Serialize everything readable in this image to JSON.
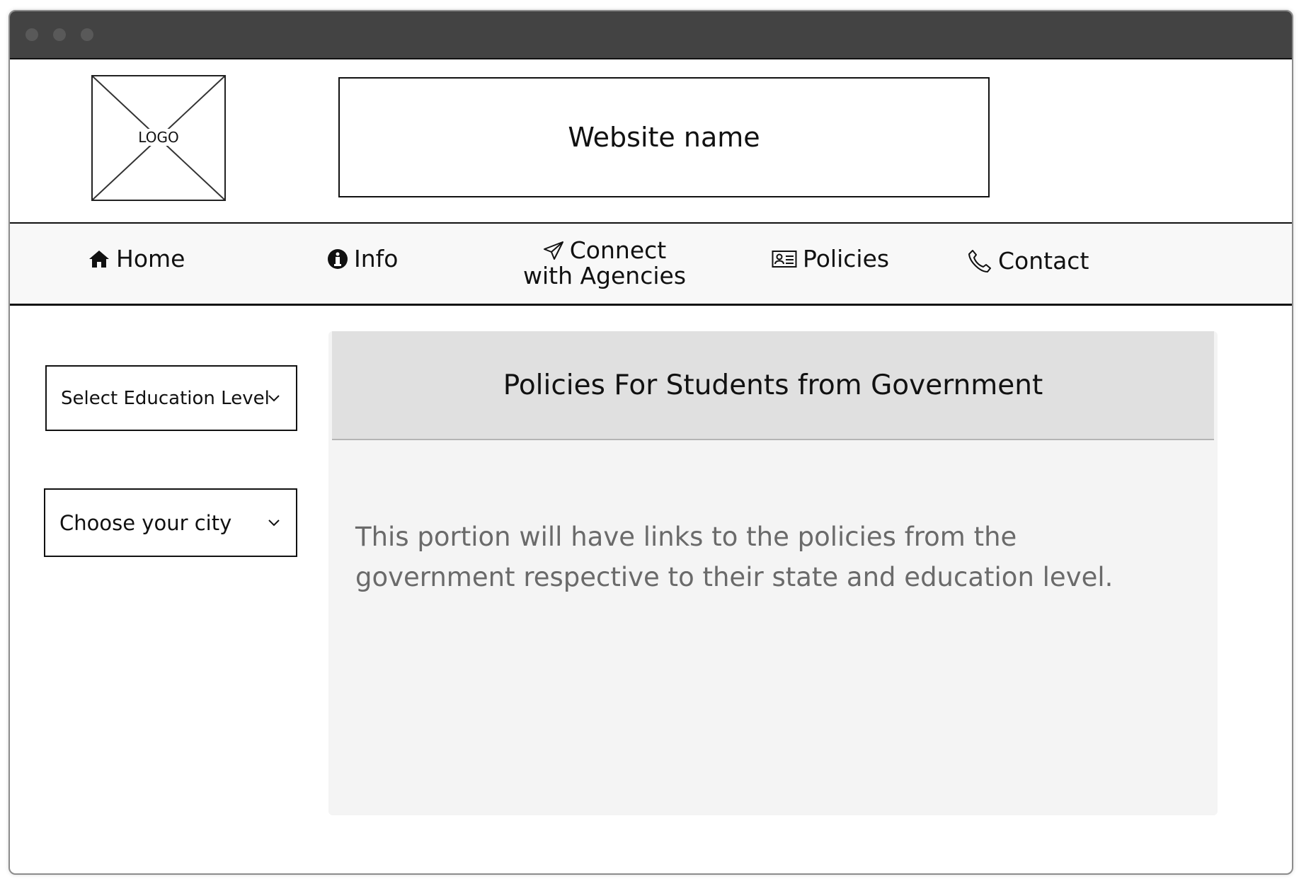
{
  "window": {
    "controls": [
      "close-dot",
      "minimize-dot",
      "maximize-dot"
    ]
  },
  "header": {
    "logo_text": "LOGO",
    "site_name": "Website name"
  },
  "nav": {
    "home": "Home",
    "info": "Info",
    "connect_line1": "Connect",
    "connect_line2": "with Agencies",
    "policies": "Policies",
    "contact": "Contact",
    "icons": {
      "home": "home-icon",
      "info": "info-icon",
      "connect": "paper-plane-icon",
      "policies": "id-card-icon",
      "contact": "phone-icon"
    }
  },
  "filters": {
    "education_level": "Select Education Level",
    "city": "Choose your city"
  },
  "panel": {
    "title": "Policies For Students from Government",
    "body": "This portion will have links to the policies from the government respective to their state and education level."
  },
  "colors": {
    "titlebar": "#434343",
    "navbar_bg": "#f8f8f8",
    "panel_bg": "#f4f4f4",
    "panel_header_bg": "#e0e0e0",
    "body_text": "#6a6a6a"
  }
}
